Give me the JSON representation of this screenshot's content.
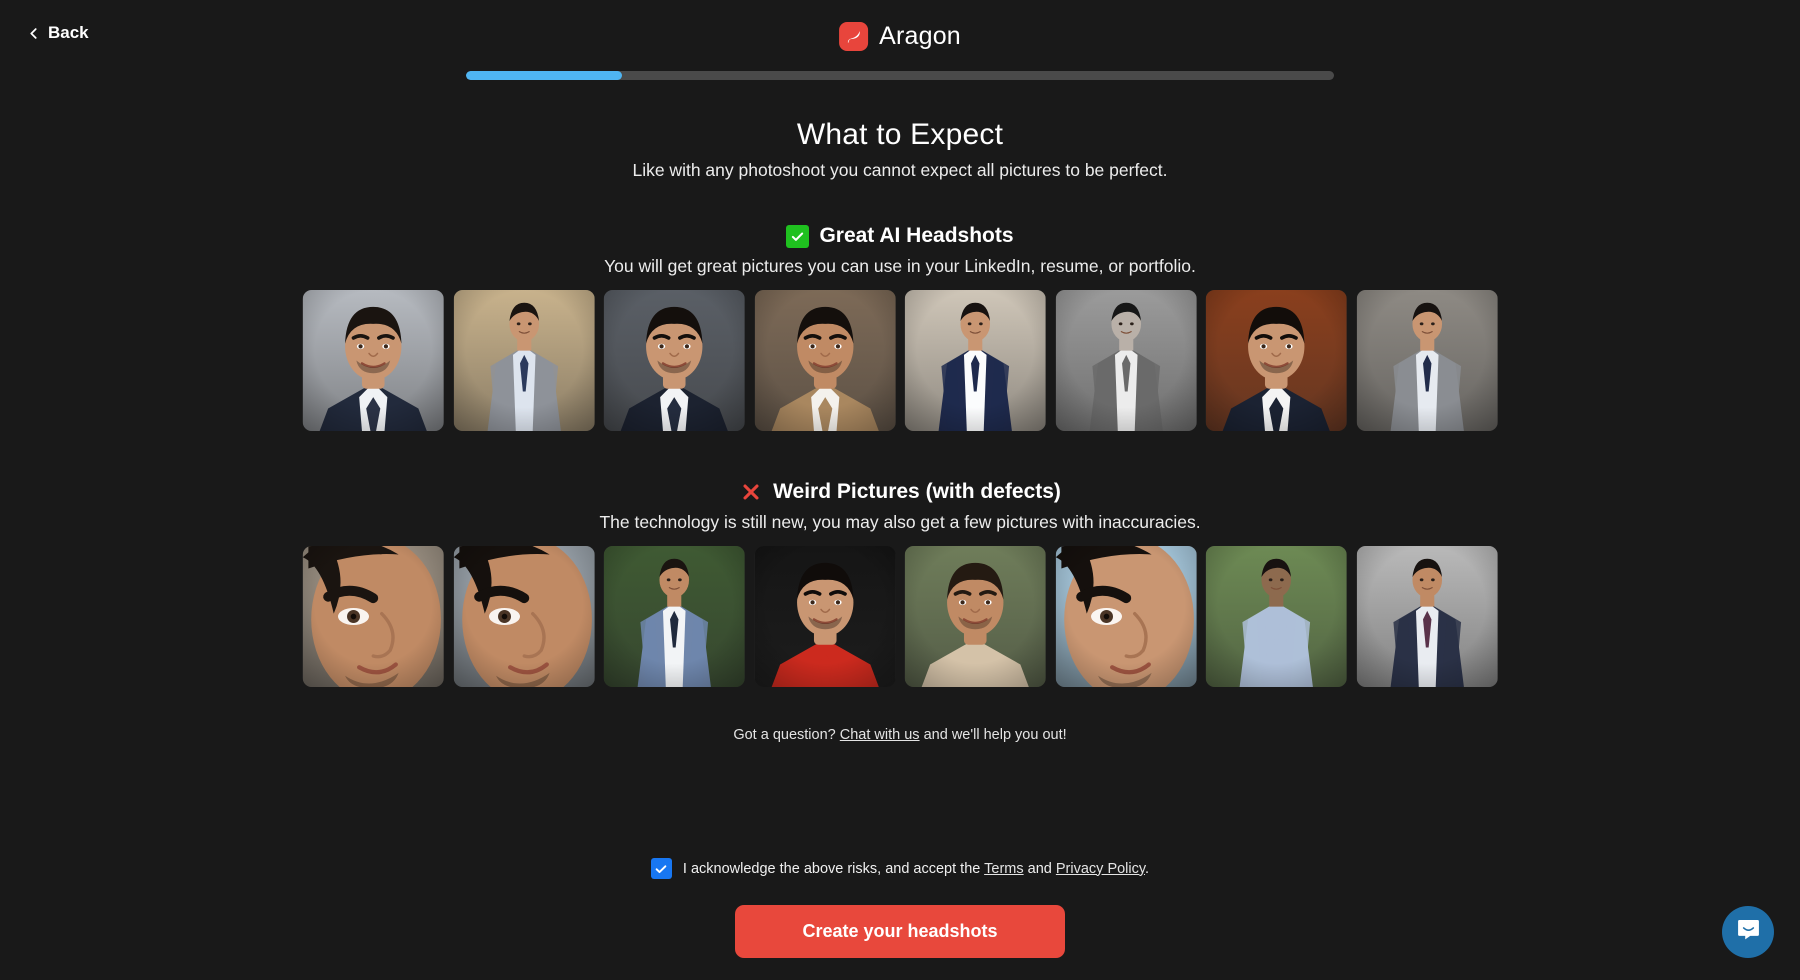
{
  "header": {
    "back_label": "Back",
    "back_icon": "chevron-left-icon",
    "brand_name": "Aragon",
    "brand_logo_icon": "aragon-leaf-logo",
    "brand_logo_color": "#E8453C"
  },
  "progress": {
    "percent": 18,
    "fill_color": "#4FB5F2",
    "track_color": "#4A4A4A"
  },
  "hero": {
    "title": "What to Expect",
    "subtitle": "Like with any photoshoot you cannot expect all pictures to be perfect."
  },
  "sections": {
    "good": {
      "icon": "green-check-icon",
      "icon_color": "#1FC11F",
      "heading": "Great AI Headshots",
      "subtitle": "You will get great pictures you can use in your LinkedIn, resume, or portfolio.",
      "images": [
        {
          "alt": "man in navy suit smiling, gray studio backdrop",
          "bg": "#b6bac0",
          "skin": "#c99672",
          "hair": "#1a1410",
          "suit": "#222a3c",
          "shirt": "#f0f2f5",
          "tie": "#2b3245",
          "crop": "head"
        },
        {
          "alt": "man in gray suit with blue tie, columned hallway",
          "bg": "#c8b28c",
          "skin": "#c99672",
          "hair": "#1a1410",
          "suit": "#8e9299",
          "shirt": "#dde4ee",
          "tie": "#2c3a5c",
          "crop": "full"
        },
        {
          "alt": "man in dark suit smiling, dark gray backdrop",
          "bg": "#5a5f66",
          "skin": "#c99672",
          "hair": "#140f0c",
          "suit": "#1c2230",
          "shirt": "#f2f3f5",
          "tie": "#242c3e",
          "crop": "head"
        },
        {
          "alt": "man in tan blazer and white shirt",
          "bg": "#7d6a57",
          "skin": "#c08a64",
          "hair": "#140f0c",
          "suit": "#a9875f",
          "shirt": "#f4f1ec",
          "tie": "#a9875f",
          "crop": "head"
        },
        {
          "alt": "man in navy blazer, hand in pocket, beige wall",
          "bg": "#cfc6b8",
          "skin": "#c99672",
          "hair": "#171210",
          "suit": "#1f2a4d",
          "shirt": "#fbfcfd",
          "tie": "#1f2a4d",
          "crop": "full"
        },
        {
          "alt": "black and white portrait, man in gray blazer",
          "bg": "#9b9b9b",
          "skin": "#b9b0a8",
          "hair": "#171717",
          "suit": "#6a6a6a",
          "shirt": "#ececec",
          "tie": "#6a6a6a",
          "crop": "full"
        },
        {
          "alt": "man smiling, warm wood-toned backdrop",
          "bg": "#8a3f1d",
          "skin": "#c99672",
          "hair": "#120d0a",
          "suit": "#1b2232",
          "shirt": "#f4f4f4",
          "tie": "#1b2232",
          "crop": "head"
        },
        {
          "alt": "man in light gray suit with navy tie",
          "bg": "#8e8a84",
          "skin": "#c99672",
          "hair": "#171210",
          "suit": "#8a8d92",
          "shirt": "#e6eaf0",
          "tie": "#222c4b",
          "crop": "full"
        }
      ]
    },
    "bad": {
      "icon": "red-x-icon",
      "icon_color": "#E8453C",
      "heading": "Weird Pictures (with defects)",
      "subtitle": "The technology is still new, you may also get a few pictures with inaccuracies.",
      "images": [
        {
          "alt": "extreme close-up of face in profile, distorted",
          "bg": "#9c9183",
          "skin": "#c08a64",
          "hair": "#1a1410",
          "suit": "#d8cfc4",
          "shirt": "#d8cfc4",
          "tie": "#d8cfc4",
          "crop": "face"
        },
        {
          "alt": "very close crop of face, melted nose defect",
          "bg": "#9aa3ab",
          "skin": "#c08a64",
          "hair": "#15100d",
          "suit": "#8d959c",
          "shirt": "#8d959c",
          "tie": "#8d959c",
          "crop": "face"
        },
        {
          "alt": "man seated in blue suit outdoors, odd hands",
          "bg": "#3f5a33",
          "skin": "#c08a64",
          "hair": "#1a1410",
          "suit": "#6f86ab",
          "shirt": "#f2f4f6",
          "tie": "#202a3d",
          "crop": "full"
        },
        {
          "alt": "man in red jacket, curly hair, warped teeth",
          "bg": "#151515",
          "skin": "#c99672",
          "hair": "#100c0a",
          "suit": "#cc2a1e",
          "shirt": "#cc2a1e",
          "tie": "#cc2a1e",
          "crop": "head"
        },
        {
          "alt": "man outdoors, hair texture artifacts",
          "bg": "#6f7d5a",
          "skin": "#c08a64",
          "hair": "#241a12",
          "suit": "#d4c2a8",
          "shirt": "#d4c2a8",
          "tie": "#d4c2a8",
          "crop": "head"
        },
        {
          "alt": "extreme close-up of eye and nose region",
          "bg": "#a9cbe0",
          "skin": "#c99672",
          "hair": "#15100d",
          "suit": "#c99672",
          "shirt": "#c99672",
          "tie": "#c99672",
          "crop": "face"
        },
        {
          "alt": "man in striped shirt in park, distorted face",
          "bg": "#6d8a54",
          "skin": "#8d6a4e",
          "hair": "#181210",
          "suit": "#aebfd8",
          "shirt": "#aebfd8",
          "tie": "#aebfd8",
          "crop": "full"
        },
        {
          "alt": "man standing in navy suit, odd proportions",
          "bg": "#b9b9b9",
          "skin": "#c08a64",
          "hair": "#171210",
          "suit": "#2a3147",
          "shirt": "#e9ecf1",
          "tie": "#59324a",
          "crop": "full"
        }
      ]
    }
  },
  "help": {
    "prefix": "Got a question?",
    "link": "Chat with us",
    "suffix": "and we'll help you out!"
  },
  "consent": {
    "checked": true,
    "checkbox_color": "#1877F2",
    "text_before": "I acknowledge the above risks, and accept the",
    "terms_link": "Terms",
    "text_between": "and",
    "privacy_link": "Privacy Policy",
    "text_after": "."
  },
  "cta": {
    "label": "Create your headshots",
    "color": "#E8483C"
  },
  "intercom": {
    "icon": "chat-bubble-icon",
    "color": "#1F6FA8"
  }
}
